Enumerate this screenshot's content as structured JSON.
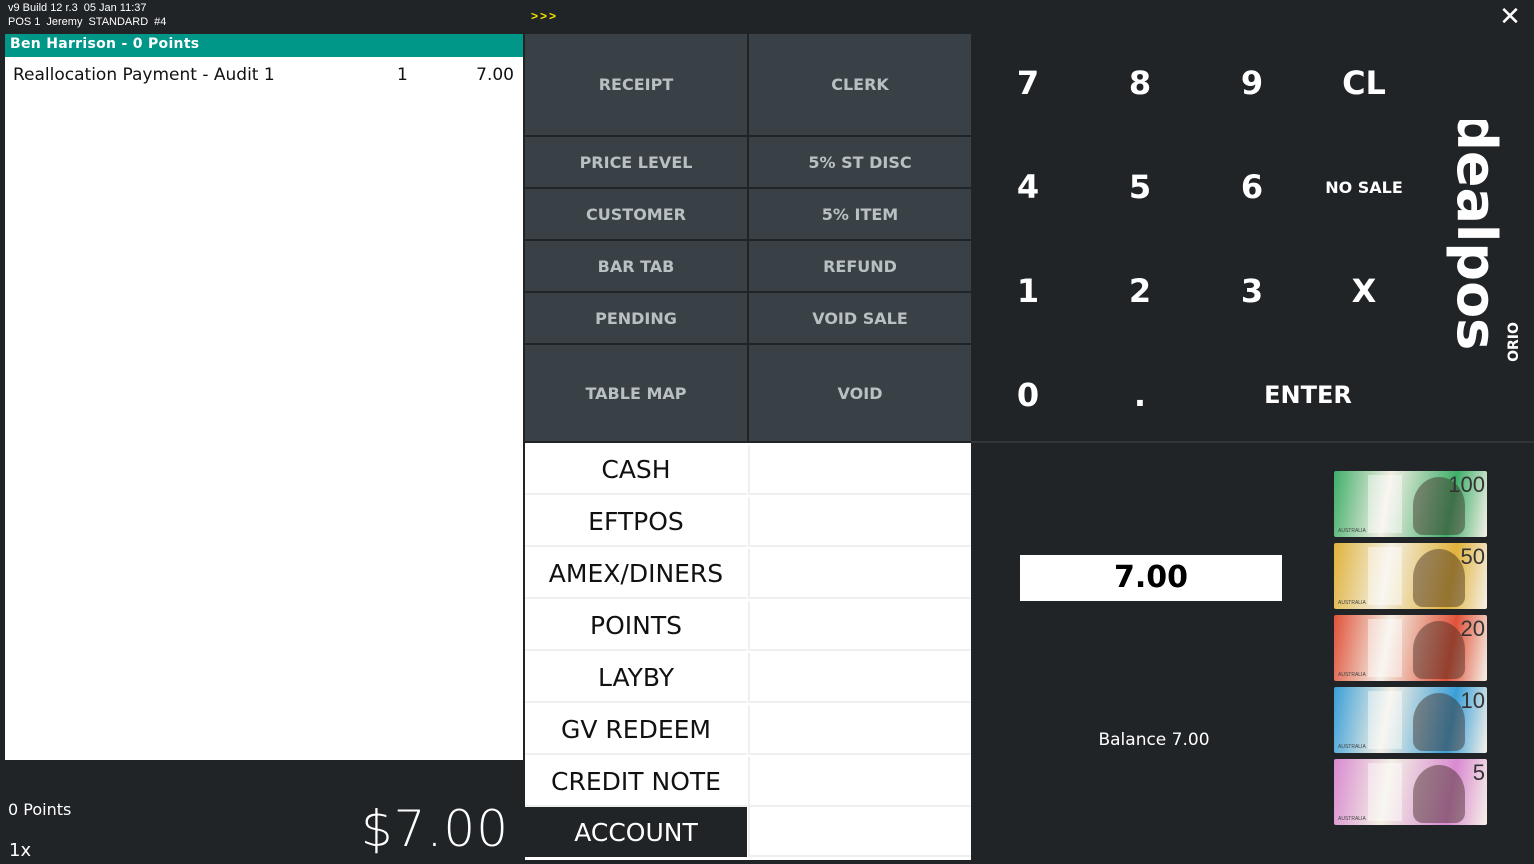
{
  "header": {
    "version": "v9 Build 12 r.3",
    "datetime": "05 Jan 11:37",
    "pos": "POS 1",
    "clerk": "Jeremy",
    "price_level": "STANDARD",
    "sale_no": "#4",
    "arrows": ">>>",
    "close_glyph": "✕"
  },
  "customer": {
    "bar_text": "Ben Harrison  -  0 Points"
  },
  "sale_lines": [
    {
      "description": "Reallocation Payment - Audit 1",
      "qty": "1",
      "price": "7.00"
    }
  ],
  "footer": {
    "points": "0 Points",
    "multiplier": "1x",
    "total": "$7.00"
  },
  "function_buttons": {
    "receipt": "RECEIPT",
    "clerk": "CLERK",
    "price_level": "PRICE LEVEL",
    "st_disc": "5% ST DISC",
    "customer": "CUSTOMER",
    "item_disc": "5% ITEM",
    "bar_tab": "BAR TAB",
    "refund": "REFUND",
    "pending": "PENDING",
    "void_sale": "VOID SALE",
    "table_map": "TABLE MAP",
    "void": "VOID"
  },
  "tenders": [
    "CASH",
    "EFTPOS",
    "AMEX/DINERS",
    "POINTS",
    "LAYBY",
    "GV REDEEM",
    "CREDIT NOTE",
    "ACCOUNT"
  ],
  "keypad": {
    "k7": "7",
    "k8": "8",
    "k9": "9",
    "cl": "CL",
    "k4": "4",
    "k5": "5",
    "k6": "6",
    "no_sale": "NO SALE",
    "k1": "1",
    "k2": "2",
    "k3": "3",
    "x": "X",
    "k0": "0",
    "dot": ".",
    "enter": "ENTER"
  },
  "logo": {
    "brand": "idealpos",
    "tag": "ORIO"
  },
  "amount": "7.00",
  "balance": "Balance 7.00",
  "banknotes": [
    {
      "denomination": "100",
      "country": "AUSTRALIA",
      "color": "#3fae6a"
    },
    {
      "denomination": "50",
      "country": "AUSTRALIA",
      "color": "#e0b23a"
    },
    {
      "denomination": "20",
      "country": "AUSTRALIA",
      "color": "#e0523a"
    },
    {
      "denomination": "10",
      "country": "AUSTRALIA",
      "color": "#3a9fd8"
    },
    {
      "denomination": "5",
      "country": "AUSTRALIA",
      "color": "#d98ad0"
    }
  ],
  "colors": {
    "accent_teal": "#009688",
    "background": "#202427",
    "button": "#3a4146"
  }
}
